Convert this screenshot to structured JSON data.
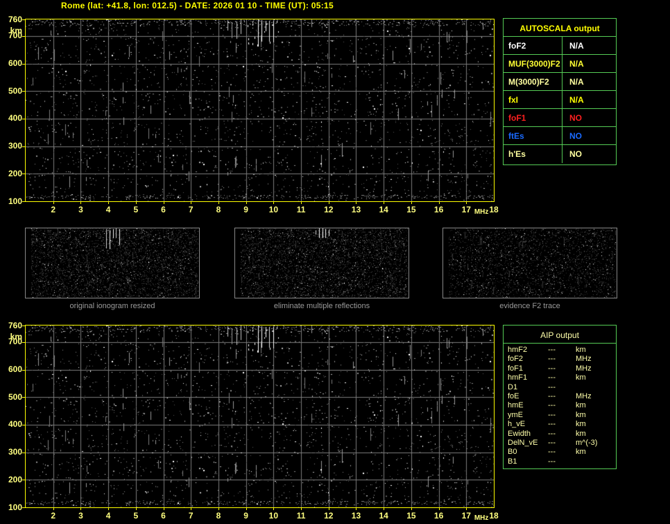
{
  "title": "Rome (lat: +41.8, lon: 012.5) - DATE: 2026 01 10 - TIME (UT): 05:15",
  "axes": {
    "y_unit": "km",
    "y_ticks": [
      "760",
      "700",
      "600",
      "500",
      "400",
      "300",
      "200",
      "100"
    ],
    "x_ticks": [
      "2",
      "3",
      "4",
      "5",
      "6",
      "7",
      "8",
      "9",
      "10",
      "11",
      "12",
      "13",
      "14",
      "15",
      "16",
      "17",
      "18"
    ],
    "x_unit": "MHz",
    "y_range": [
      100,
      760
    ],
    "x_range": [
      1,
      18
    ]
  },
  "autoscala": {
    "title": "AUTOSCALA output",
    "rows": [
      {
        "label": "foF2",
        "value": "N/A",
        "color": "#ffffff"
      },
      {
        "label": "MUF(3000)F2",
        "value": "N/A",
        "color": "#ffff33"
      },
      {
        "label": "M(3000)F2",
        "value": "N/A",
        "color": "#ffffa0"
      },
      {
        "label": "fxI",
        "value": "N/A",
        "color": "#ffff00"
      },
      {
        "label": "foF1",
        "value": "NO",
        "color": "#ff2020"
      },
      {
        "label": "ftEs",
        "value": "NO",
        "color": "#1a6aff"
      },
      {
        "label": "h'Es",
        "value": "NO",
        "color": "#ffffa0"
      }
    ]
  },
  "thumbnails": [
    {
      "caption": "original ionogram resized"
    },
    {
      "caption": "eliminate multiple reflections"
    },
    {
      "caption": "evidence F2 trace"
    }
  ],
  "aip": {
    "title": "AIP output",
    "rows": [
      {
        "label": "hmF2",
        "value": "---",
        "unit": "km"
      },
      {
        "label": "foF2",
        "value": "---",
        "unit": "MHz"
      },
      {
        "label": "foF1",
        "value": "---",
        "unit": "MHz"
      },
      {
        "label": "hmF1",
        "value": "---",
        "unit": "km"
      },
      {
        "label": "D1",
        "value": "---",
        "unit": ""
      },
      {
        "label": "foE",
        "value": "---",
        "unit": "MHz"
      },
      {
        "label": "hmE",
        "value": "---",
        "unit": "km"
      },
      {
        "label": "ymE",
        "value": "---",
        "unit": "km"
      },
      {
        "label": "h_vE",
        "value": "---",
        "unit": "km"
      },
      {
        "label": "Ewidth",
        "value": "---",
        "unit": "km"
      },
      {
        "label": "DelN_vE",
        "value": "---",
        "unit": "m^(-3)"
      },
      {
        "label": "B0",
        "value": "---",
        "unit": "km"
      },
      {
        "label": "B1",
        "value": "---",
        "unit": ""
      }
    ]
  },
  "colors": {
    "background": "#000000",
    "title_text": "#ffff00",
    "axis_text": "#ffff80",
    "plot_border": "#ffff00",
    "grid_line": "#7d7d7d",
    "table_border": "#55cc55",
    "autoscala_header_text": "#ffff00",
    "aip_text": "#ffffaa",
    "caption_text": "#9a9a9a",
    "thumb_border": "#888888"
  },
  "chart_data": [
    {
      "type": "heatmap",
      "title": "ionogram (top, raw with grid)",
      "xlabel": "MHz",
      "ylabel": "km",
      "x_range": [
        1,
        18
      ],
      "y_range": [
        100,
        760
      ],
      "x_ticks": [
        2,
        3,
        4,
        5,
        6,
        7,
        8,
        9,
        10,
        11,
        12,
        13,
        14,
        15,
        16,
        17,
        18
      ],
      "y_ticks": [
        100,
        200,
        300,
        400,
        500,
        600,
        700,
        760
      ],
      "grid": true,
      "note": "No ionospheric echo trace detected - background noise speckle only; RFI streaks near 9.5-10 MHz at top; all AUTOSCALA parameters N/A or NO"
    },
    {
      "type": "heatmap",
      "title": "ionogram (bottom, AIP stage)",
      "xlabel": "MHz",
      "ylabel": "km",
      "x_range": [
        1,
        18
      ],
      "y_range": [
        100,
        760
      ],
      "x_ticks": [
        2,
        3,
        4,
        5,
        6,
        7,
        8,
        9,
        10,
        11,
        12,
        13,
        14,
        15,
        16,
        17,
        18
      ],
      "y_ticks": [
        100,
        200,
        300,
        400,
        500,
        600,
        700,
        760
      ],
      "grid": true,
      "note": "Same noise-only ionogram; all AIP parameters ---"
    }
  ]
}
